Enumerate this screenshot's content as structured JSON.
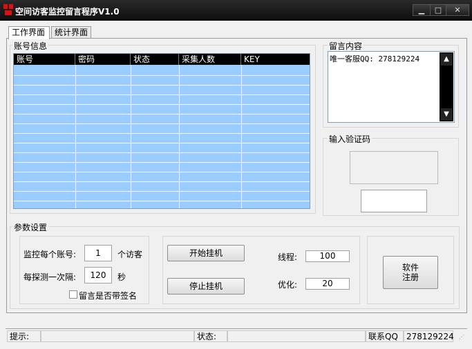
{
  "window": {
    "title": "空间访客监控留言程序V1.0",
    "min_glyph": "▁",
    "max_glyph": "□",
    "close_glyph": "✕"
  },
  "tabs": [
    {
      "label": "工作界面",
      "active": true
    },
    {
      "label": "统计界面",
      "active": false
    }
  ],
  "accounts": {
    "group_label": "账号信息",
    "columns": [
      "账号",
      "密码",
      "状态",
      "采集人数",
      "KEY"
    ]
  },
  "message": {
    "group_label": "留言内容",
    "text": "唯一客服QQ: 278129224",
    "scroll_up": "▲",
    "scroll_down": "▼"
  },
  "captcha": {
    "group_label": "输入验证码",
    "value": ""
  },
  "params": {
    "group_label": "参数设置",
    "monitor_label": "监控每个账号:",
    "monitor_value": "1",
    "monitor_unit": "个访客",
    "interval_label": "每探测一次隔:",
    "interval_value": "120",
    "interval_unit": "秒",
    "signature_label": "留言是否带签名",
    "signature_checked": false,
    "start_button": "开始挂机",
    "stop_button": "停止挂机",
    "threads_label": "线程:",
    "threads_value": "100",
    "optimize_label": "优化:",
    "optimize_value": "20",
    "register_button_line1": "软件",
    "register_button_line2": "注册"
  },
  "statusbar": {
    "hint_label": "提示:",
    "hint_value": "",
    "status_label": "状态:",
    "status_value": "",
    "contact": "联系QQ",
    "contact_qq": "278129224"
  },
  "colors": {
    "listview_bg": "#99ccff",
    "titlebar_bg": "#0d0d0d"
  }
}
